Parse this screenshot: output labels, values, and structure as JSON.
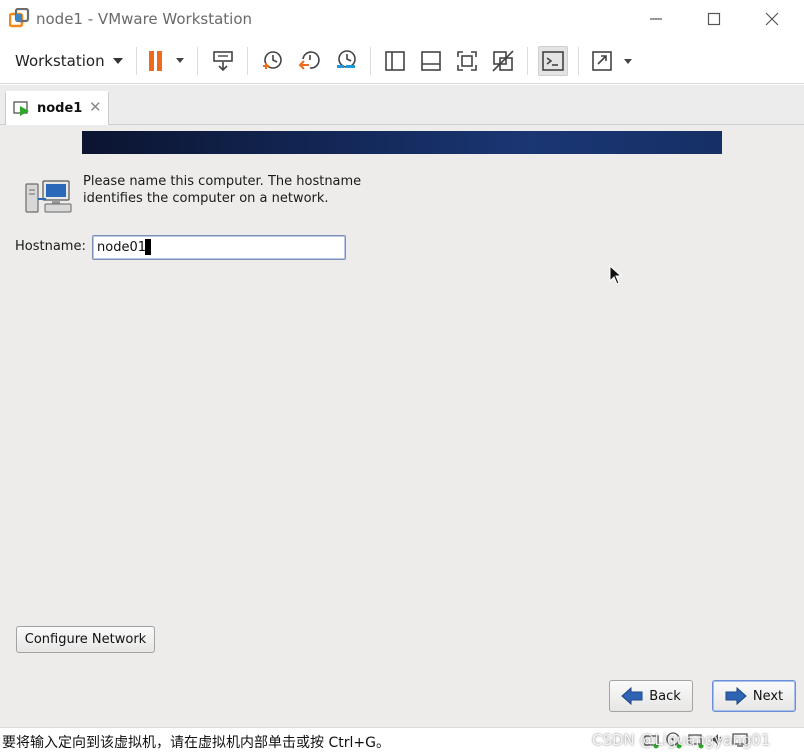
{
  "window": {
    "title": "node1 - VMware Workstation",
    "icon": "vmware-logo-icon",
    "controls": [
      "minimize-icon",
      "maximize-icon",
      "close-icon"
    ]
  },
  "toolbar": {
    "menu_label": "Workstation",
    "buttons": [
      "pause-icon",
      "send-ctrl-alt-del-icon",
      "snapshot-icon",
      "revert-snapshot-icon",
      "snapshot-manager-icon",
      "library-icon",
      "thumbnail-bar-icon",
      "fit-guest-icon",
      "unity-icon",
      "console-icon",
      "fullscreen-icon"
    ]
  },
  "tabs": [
    {
      "label": "node1",
      "active": true
    }
  ],
  "vm": {
    "description": "Please name this computer.  The hostname identifies the computer on a network.",
    "hostname_label": "Hostname:",
    "hostname_value": "node01",
    "configure_network_label": "Configure Network",
    "back_label": "Back",
    "next_label": "Next"
  },
  "status": {
    "message": "要将输入定向到该虚拟机，请在虚拟机内部单击或按 Ctrl+G。",
    "watermark": "CSDN @Liguangyang01"
  },
  "colors": {
    "banner": "#142a5c",
    "pause_accent": "#ee6a1f",
    "vm_background": "#edeceb"
  }
}
